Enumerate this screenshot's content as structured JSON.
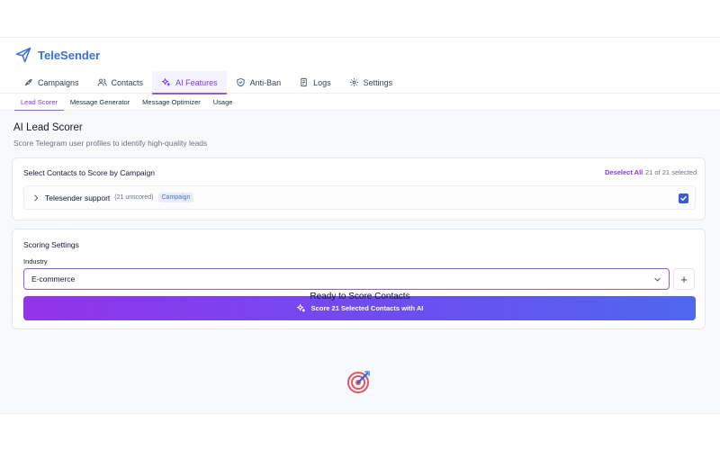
{
  "app": {
    "name": "TeleSender",
    "brand_color": "#3b6fd8",
    "brand_icon": "send-icon"
  },
  "main_tabs": [
    {
      "label": "Campaigns",
      "icon": "rocket-icon"
    },
    {
      "label": "Contacts",
      "icon": "users-icon"
    },
    {
      "label": "AI Features",
      "icon": "sparkles-icon",
      "active": true
    },
    {
      "label": "Anti-Ban",
      "icon": "shield-icon"
    },
    {
      "label": "Logs",
      "icon": "document-icon"
    },
    {
      "label": "Settings",
      "icon": "gear-icon"
    }
  ],
  "sub_tabs": [
    {
      "label": "Lead Scorer",
      "active": true
    },
    {
      "label": "Message Generator"
    },
    {
      "label": "Message Optimizer"
    },
    {
      "label": "Usage"
    }
  ],
  "page": {
    "title": "AI Lead Scorer",
    "subtitle": "Score Telegram user profiles to identify high-quality leads"
  },
  "contacts_card": {
    "title": "Select Contacts to Score by Campaign",
    "deselect_label": "Deselect All",
    "selected_count": "21 of 21 selected",
    "campaign": {
      "name": "Telesender support",
      "unscored": "(21 unscored)",
      "badge": "Campaign",
      "checked": true
    }
  },
  "scoring_card": {
    "title": "Scoring Settings",
    "industry_label": "Industry",
    "industry_value": "E-commerce",
    "add_label": "+",
    "score_button": "Score 21 Selected Contacts with AI"
  },
  "empty_state": {
    "icon": "target-icon",
    "title": "Ready to Score Contacts"
  },
  "colors": {
    "accent": "#8b5cf6",
    "accent_text": "#7c3aed",
    "checkbox": "#3b5bdb"
  }
}
